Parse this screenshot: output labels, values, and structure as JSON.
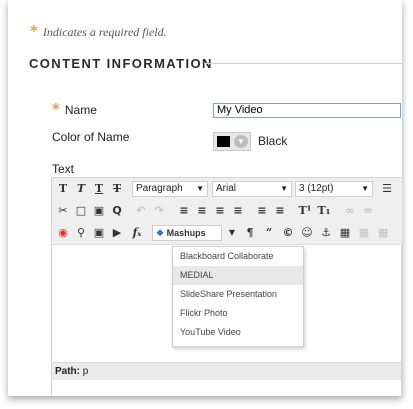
{
  "required_note": "Indicates a required field.",
  "required_marker": "*",
  "section_title": "CONTENT INFORMATION",
  "name_field": {
    "label": "Name",
    "value": "My Video"
  },
  "color_field": {
    "label": "Color of Name",
    "swatch_color": "#000000",
    "value": "Black"
  },
  "text_label": "Text",
  "toolbar": {
    "row1": {
      "paragraph": "Paragraph",
      "font": "Arial",
      "size": "3 (12pt)"
    },
    "mashups_label": "Mashups"
  },
  "mashups_menu": {
    "items": [
      "Blackboard Collaborate",
      "MEDIAL",
      "SlideShare Presentation",
      "Flickr Photo",
      "YouTube Video"
    ],
    "highlighted": "MEDIAL"
  },
  "path": {
    "label": "Path:",
    "value": "p"
  },
  "colors": {
    "required_star": "#e8a033",
    "input_border": "#6aa9d8",
    "rule": "#c9d6df"
  }
}
